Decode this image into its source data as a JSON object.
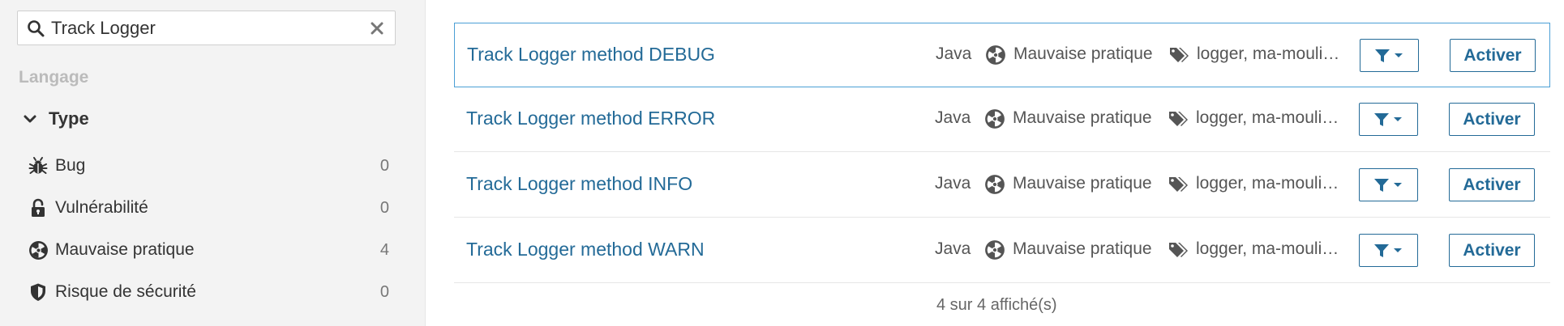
{
  "search": {
    "value": "Track Logger",
    "placeholder": ""
  },
  "sidebar": {
    "facet_title": "Langage",
    "type_header": "Type",
    "types": [
      {
        "label": "Bug",
        "count": "0",
        "icon": "bug-icon"
      },
      {
        "label": "Vulnérabilité",
        "count": "0",
        "icon": "unlock-icon"
      },
      {
        "label": "Mauvaise pratique",
        "count": "4",
        "icon": "radiation-icon"
      },
      {
        "label": "Risque de sécurité",
        "count": "0",
        "icon": "shield-icon"
      }
    ]
  },
  "rules": [
    {
      "name": "Track Logger method DEBUG",
      "lang": "Java",
      "type": "Mauvaise pratique",
      "tags": "logger, ma-moulinette",
      "activate_label": "Activer"
    },
    {
      "name": "Track Logger method ERROR",
      "lang": "Java",
      "type": "Mauvaise pratique",
      "tags": "logger, ma-moulinette",
      "activate_label": "Activer"
    },
    {
      "name": "Track Logger method INFO",
      "lang": "Java",
      "type": "Mauvaise pratique",
      "tags": "logger, ma-moulinette",
      "activate_label": "Activer"
    },
    {
      "name": "Track Logger method WARN",
      "lang": "Java",
      "type": "Mauvaise pratique",
      "tags": "logger, ma-moulinette",
      "activate_label": "Activer"
    }
  ],
  "footer": {
    "count_text": "4 sur 4 affiché(s)"
  },
  "colors": {
    "link": "#236a97",
    "selected_border": "#4b9fd5",
    "sidebar_bg": "#f3f3f3"
  }
}
